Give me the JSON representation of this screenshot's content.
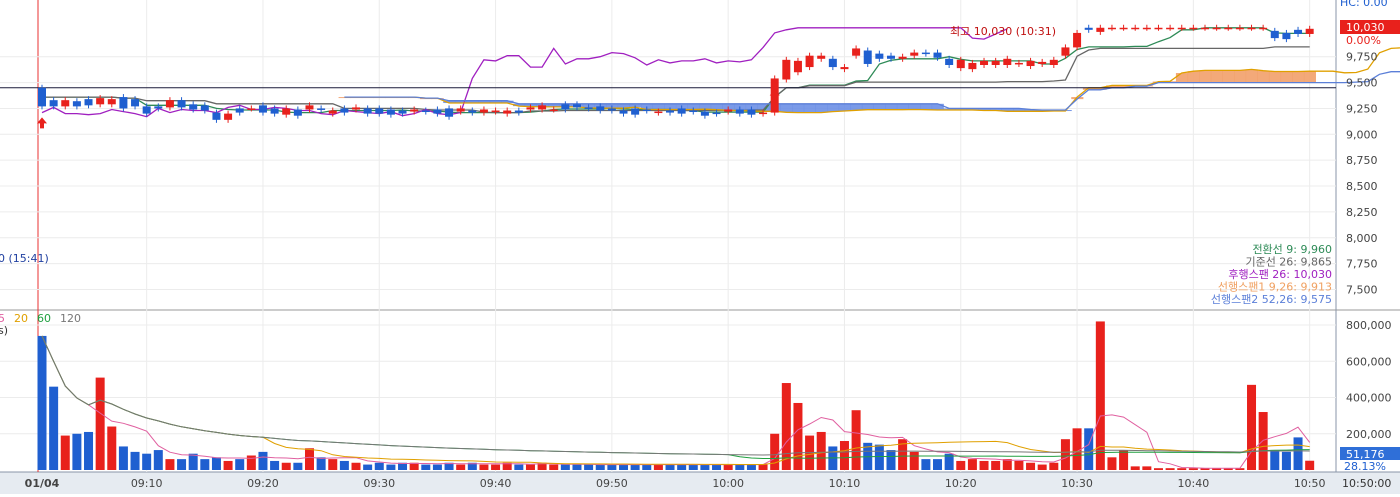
{
  "header": {
    "partial_label": "HC: 0.00"
  },
  "price_panel": {
    "y_ticks": [
      "9,750",
      "9,500",
      "9,250",
      "9,000",
      "8,750",
      "8,500",
      "8,250",
      "8,000",
      "7,750",
      "7,500"
    ],
    "y_tick_values": [
      9750,
      9500,
      9250,
      9000,
      8750,
      8500,
      8250,
      8000,
      7750,
      7500
    ],
    "current_price_label": "10,030",
    "change_label": "0.00%",
    "high_annotation": "최고 10,030 (10:31)",
    "low_annotation": "0 (15:41)",
    "legend": [
      {
        "label": "전환선 9: 9,960",
        "color": "#2e8b57"
      },
      {
        "label": "기준선 26: 9,865",
        "color": "#666666"
      },
      {
        "label": "후행스팬 26: 10,030",
        "color": "#a020c0"
      },
      {
        "label": "선행스팬1 9,26: 9,913",
        "color": "#f0a060"
      },
      {
        "label": "선행스팬2 52,26: 9,575",
        "color": "#5b7fd8"
      }
    ],
    "horizontal_line_value": 9450
  },
  "volume_panel": {
    "ma_labels": [
      {
        "text": "5",
        "color": "#e060a0"
      },
      {
        "text": "20",
        "color": "#e0a000"
      },
      {
        "text": "60",
        "color": "#20a040"
      },
      {
        "text": "120",
        "color": "#777777"
      }
    ],
    "partial_label": "s)",
    "y_ticks": [
      "800,000",
      "600,000",
      "400,000",
      "200,000"
    ],
    "y_tick_values": [
      800000,
      600000,
      400000,
      200000
    ],
    "current_volume_label": "51,176",
    "ratio_label": "28.13%"
  },
  "x_axis": {
    "labels": [
      "01/04",
      "09:10",
      "09:20",
      "09:30",
      "09:40",
      "09:50",
      "10:00",
      "10:10",
      "10:20",
      "10:30",
      "10:40",
      "10:50"
    ],
    "corner_label": "10:50:00"
  },
  "colors": {
    "up": "#e8211c",
    "down": "#1f5fd0",
    "cloud": "#f2a06a",
    "cloud_alt": "#6b8fe6"
  },
  "chart_data": {
    "type": "candlestick",
    "x": [
      "09:01",
      "09:02",
      "09:03",
      "09:04",
      "09:05",
      "09:06",
      "09:07",
      "09:08",
      "09:09",
      "09:10",
      "09:11",
      "09:12",
      "09:13",
      "09:14",
      "09:15",
      "09:16",
      "09:17",
      "09:18",
      "09:19",
      "09:20",
      "09:21",
      "09:22",
      "09:23",
      "09:24",
      "09:25",
      "09:26",
      "09:27",
      "09:28",
      "09:29",
      "09:30",
      "09:31",
      "09:32",
      "09:33",
      "09:34",
      "09:35",
      "09:36",
      "09:37",
      "09:38",
      "09:39",
      "09:40",
      "09:41",
      "09:42",
      "09:43",
      "09:44",
      "09:45",
      "09:46",
      "09:47",
      "09:48",
      "09:49",
      "09:50",
      "09:51",
      "09:52",
      "09:53",
      "09:54",
      "09:55",
      "09:56",
      "09:57",
      "09:58",
      "09:59",
      "10:00",
      "10:01",
      "10:02",
      "10:03",
      "10:04",
      "10:05",
      "10:06",
      "10:07",
      "10:08",
      "10:09",
      "10:10",
      "10:11",
      "10:12",
      "10:13",
      "10:14",
      "10:15",
      "10:16",
      "10:17",
      "10:18",
      "10:19",
      "10:20",
      "10:21",
      "10:22",
      "10:23",
      "10:24",
      "10:25",
      "10:26",
      "10:27",
      "10:28",
      "10:29",
      "10:30",
      "10:31",
      "10:32",
      "10:33",
      "10:34",
      "10:35",
      "10:36",
      "10:37",
      "10:38",
      "10:39",
      "10:40",
      "10:41",
      "10:42",
      "10:43",
      "10:44",
      "10:45",
      "10:46",
      "10:47",
      "10:48",
      "10:49",
      "10:50"
    ],
    "open": [
      9450,
      9330,
      9270,
      9320,
      9340,
      9290,
      9290,
      9360,
      9340,
      9270,
      9270,
      9260,
      9330,
      9290,
      9280,
      9210,
      9140,
      9250,
      9250,
      9280,
      9250,
      9190,
      9240,
      9240,
      9250,
      9200,
      9250,
      9240,
      9250,
      9250,
      9240,
      9230,
      9220,
      9230,
      9240,
      9250,
      9220,
      9230,
      9210,
      9220,
      9200,
      9230,
      9240,
      9240,
      9240,
      9290,
      9290,
      9260,
      9270,
      9250,
      9230,
      9250,
      9240,
      9210,
      9230,
      9250,
      9230,
      9220,
      9210,
      9220,
      9240,
      9240,
      9200,
      9210,
      9530,
      9600,
      9650,
      9730,
      9730,
      9630,
      9760,
      9810,
      9780,
      9760,
      9730,
      9760,
      9790,
      9790,
      9730,
      9640,
      9630,
      9670,
      9670,
      9670,
      9680,
      9660,
      9680,
      9670,
      9760,
      9840,
      10030,
      9990,
      10030,
      10030,
      10030,
      10030,
      10030,
      10030,
      10030,
      10030,
      10030,
      10030,
      10030,
      10030,
      10030,
      10030,
      10000,
      9980,
      10010,
      9970
    ],
    "close": [
      9270,
      9270,
      9330,
      9270,
      9280,
      9350,
      9340,
      9250,
      9270,
      9200,
      9250,
      9330,
      9260,
      9240,
      9230,
      9140,
      9200,
      9210,
      9250,
      9210,
      9200,
      9250,
      9180,
      9280,
      9240,
      9230,
      9210,
      9260,
      9200,
      9200,
      9190,
      9200,
      9240,
      9220,
      9200,
      9170,
      9250,
      9210,
      9240,
      9230,
      9230,
      9210,
      9260,
      9280,
      9240,
      9240,
      9260,
      9250,
      9230,
      9230,
      9200,
      9190,
      9230,
      9220,
      9210,
      9200,
      9220,
      9180,
      9200,
      9240,
      9200,
      9190,
      9210,
      9540,
      9720,
      9710,
      9760,
      9760,
      9650,
      9650,
      9830,
      9680,
      9730,
      9730,
      9750,
      9790,
      9780,
      9740,
      9670,
      9720,
      9690,
      9710,
      9710,
      9730,
      9690,
      9710,
      9700,
      9720,
      9840,
      9980,
      10010,
      10030,
      10030,
      10030,
      10030,
      10030,
      10030,
      10030,
      10030,
      10030,
      10030,
      10030,
      10030,
      10030,
      10030,
      10030,
      9930,
      9920,
      9970,
      10020
    ],
    "volume": [
      740000,
      460000,
      190000,
      200000,
      210000,
      510000,
      240000,
      130000,
      100000,
      90000,
      110000,
      60000,
      60000,
      90000,
      60000,
      70000,
      50000,
      60000,
      80000,
      100000,
      50000,
      40000,
      40000,
      120000,
      70000,
      60000,
      50000,
      40000,
      30000,
      40000,
      30000,
      40000,
      40000,
      30000,
      30000,
      40000,
      30000,
      40000,
      30000,
      30000,
      40000,
      30000,
      30000,
      40000,
      30000,
      30000,
      30000,
      30000,
      30000,
      30000,
      30000,
      30000,
      30000,
      30000,
      30000,
      30000,
      30000,
      30000,
      30000,
      30000,
      30000,
      30000,
      30000,
      200000,
      480000,
      370000,
      190000,
      210000,
      130000,
      160000,
      330000,
      150000,
      140000,
      110000,
      170000,
      100000,
      60000,
      60000,
      90000,
      50000,
      60000,
      50000,
      50000,
      60000,
      50000,
      40000,
      30000,
      40000,
      170000,
      230000,
      230000,
      820000,
      70000,
      110000,
      20000,
      20000,
      10000,
      10000,
      10000,
      10000,
      10000,
      10000,
      10000,
      10000,
      470000,
      320000,
      110000,
      100000,
      180000,
      51176
    ],
    "ylim": [
      7350,
      10250
    ],
    "volume_ylim": [
      0,
      850000
    ]
  }
}
